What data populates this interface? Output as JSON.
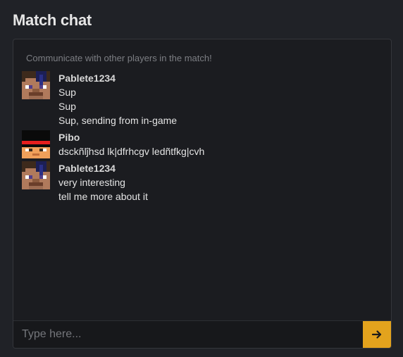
{
  "title": "Match chat",
  "subtitle": "Communicate with other players in the match!",
  "groups": [
    {
      "username": "Pablete1234",
      "avatar": "steve-skin-avatar",
      "messages": [
        "Sup",
        "Sup",
        "Sup, sending from in-game"
      ]
    },
    {
      "username": "Pibo",
      "avatar": "black-hat-skin-avatar",
      "messages": [
        "dsckñlĵhsd lk|dfrhcgv ledñtfkg|cvh"
      ]
    },
    {
      "username": "Pablete1234",
      "avatar": "steve-skin-avatar",
      "messages": [
        "very interesting",
        "tell me more about it"
      ]
    }
  ],
  "composer": {
    "placeholder": "Type here...",
    "value": "",
    "send_icon": "arrow-right-icon"
  },
  "colors": {
    "accent": "#e3a31d",
    "background": "#202227",
    "panel": "#1b1c20"
  }
}
